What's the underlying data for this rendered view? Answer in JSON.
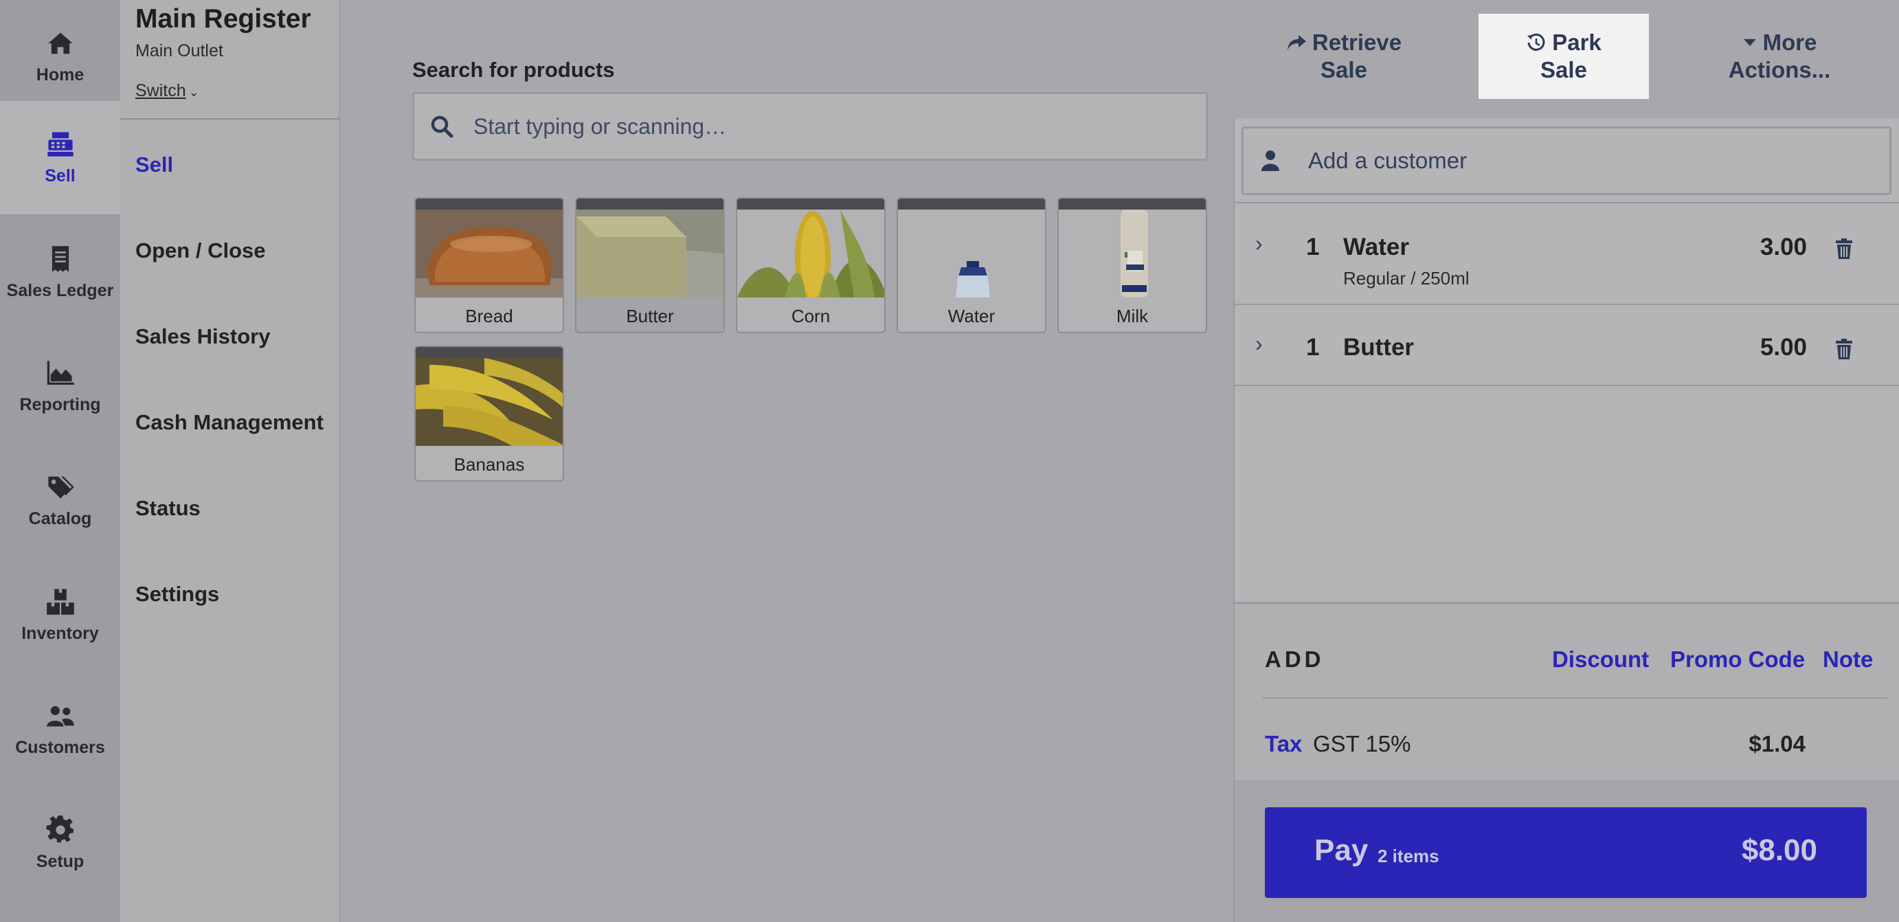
{
  "nav": {
    "items": [
      {
        "label": "Home",
        "icon": "home-icon"
      },
      {
        "label": "Sell",
        "icon": "cash-register-icon",
        "active": true
      },
      {
        "label": "Sales Ledger",
        "icon": "receipt-icon"
      },
      {
        "label": "Reporting",
        "icon": "area-chart-icon"
      },
      {
        "label": "Catalog",
        "icon": "tags-icon"
      },
      {
        "label": "Inventory",
        "icon": "boxes-icon"
      },
      {
        "label": "Customers",
        "icon": "users-icon"
      },
      {
        "label": "Setup",
        "icon": "gear-icon"
      }
    ]
  },
  "register": {
    "title": "Main Register",
    "outlet": "Main Outlet",
    "switch_label": "Switch"
  },
  "subnav": {
    "items": [
      "Sell",
      "Open / Close",
      "Sales History",
      "Cash Management",
      "Status",
      "Settings"
    ],
    "active": "Sell"
  },
  "search": {
    "label": "Search for products",
    "placeholder": "Start typing or scanning…"
  },
  "products": [
    "Bread",
    "Butter",
    "Corn",
    "Water",
    "Milk",
    "Bananas"
  ],
  "header_actions": {
    "retrieve": [
      "Retrieve",
      "Sale"
    ],
    "park": [
      "Park",
      "Sale"
    ],
    "more": [
      "More",
      "Actions..."
    ]
  },
  "sale": {
    "customer_placeholder": "Add a customer",
    "lines": [
      {
        "qty": "1",
        "name": "Water",
        "variant": "Regular / 250ml",
        "price": "3.00"
      },
      {
        "qty": "1",
        "name": "Butter",
        "variant": "",
        "price": "5.00"
      }
    ],
    "add_label": "ADD",
    "add_links": [
      "Discount",
      "Promo Code",
      "Note"
    ],
    "tax_label": "Tax",
    "tax_name": "GST 15%",
    "tax_value": "$1.04",
    "pay_label": "Pay",
    "pay_items": "2 items",
    "pay_amount": "$8.00"
  },
  "colors": {
    "accent": "#2a25b6",
    "overlay": "#a8a7ab"
  }
}
